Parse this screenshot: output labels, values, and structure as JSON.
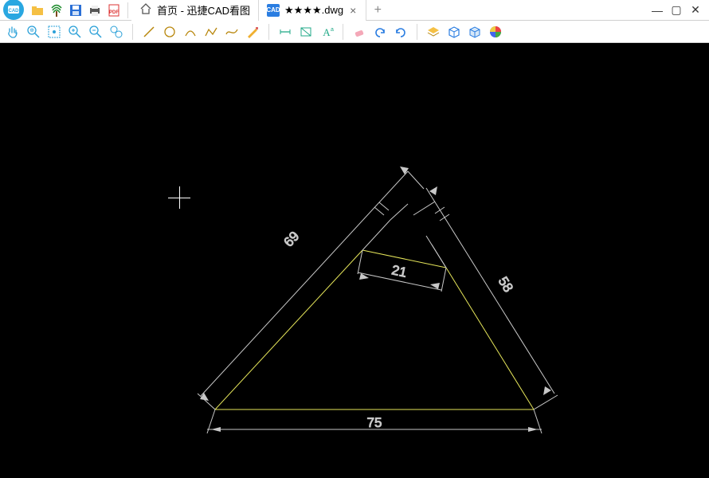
{
  "app": {
    "title_tab": "首页 - 迅捷CAD看图"
  },
  "tabs": {
    "home_label": "首页 - 迅捷CAD看图",
    "file_label": "★★★★.dwg",
    "dwg_icon_text": "CAD"
  },
  "window_controls": {
    "minimize": "—",
    "maximize": "▢",
    "close": "✕"
  },
  "toolbar_icons": {
    "open": "open-icon",
    "palm": "palm-icon",
    "save": "save-icon",
    "print": "print-icon",
    "pdf": "pdf-icon"
  },
  "drawing": {
    "dimensions": {
      "base": "75",
      "left_side": "69",
      "right_side": "58",
      "top_gap": "21"
    }
  }
}
